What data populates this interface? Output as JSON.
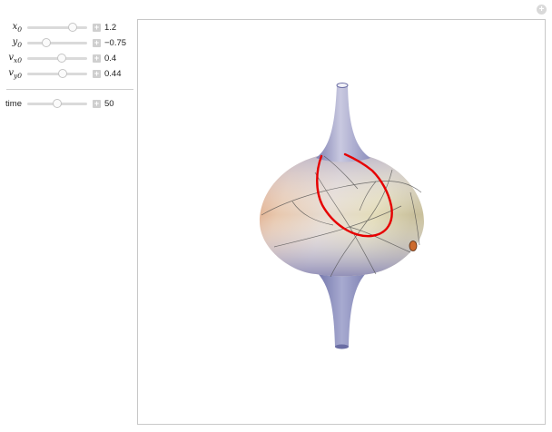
{
  "controls": [
    {
      "id": "x0",
      "var": "x",
      "sub": "0",
      "value": "1.2",
      "fraction": 0.75
    },
    {
      "id": "y0",
      "var": "y",
      "sub": "0",
      "value": "−0.75",
      "fraction": 0.32
    },
    {
      "id": "vx0",
      "var": "v",
      "sub": "x0",
      "value": "0.4",
      "fraction": 0.58
    },
    {
      "id": "vy0",
      "var": "v",
      "sub": "y0",
      "value": "0.44",
      "fraction": 0.59
    }
  ],
  "time_control": {
    "label": "time",
    "value": "50",
    "fraction": 0.5
  },
  "plus_symbol": "+",
  "colors": {
    "trajectory": "#e60000",
    "surface_blue": "#a6a8cf",
    "surface_orange": "#d9946c",
    "surface_yellow": "#e6dfb4"
  },
  "icons": {
    "corner": "plus-circle-icon",
    "increment": "plus-square-icon"
  }
}
